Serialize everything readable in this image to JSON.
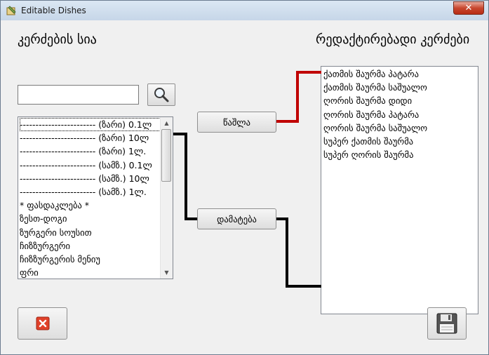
{
  "window": {
    "title": "Editable Dishes",
    "close_glyph": "✕"
  },
  "labels": {
    "dish_list": "კერძების სია",
    "editable_dishes": "რედაქტირებადი კერძები"
  },
  "search": {
    "value": "",
    "placeholder": ""
  },
  "left_list": {
    "items": [
      "------------------------ (ზარი) 0.1ლ",
      "------------------------ (ზარი) 10ლ",
      "------------------------ (ზარი) 1ლ.",
      "------------------------ (სამზ.) 0.1ლ",
      "------------------------ (სამზ.) 10ლ",
      "------------------------ (სამზ.) 1ლ.",
      "* ფასდაკლება *",
      "ზესთ-დოგი",
      "ზურგერი სოუსით",
      "ჩიზზურგერი",
      "ჩიზზურგერის მენიუ",
      "ფრი"
    ]
  },
  "right_list": {
    "items": [
      "ქათმის შაურმა პატარა",
      "ქათმის შაურმა საშუალო",
      "ღორის შაურმა დიდი",
      "ღორის შაურმა პატარა",
      "ღორის შაურმა საშუალო",
      "სუპერ ქათმის შაურმა",
      "სუპერ ღორის შაურმა"
    ]
  },
  "buttons": {
    "remove": "წაშლა",
    "add": "დამატება"
  },
  "colors": {
    "remove_wire": "#c00000",
    "add_wire": "#000000"
  }
}
